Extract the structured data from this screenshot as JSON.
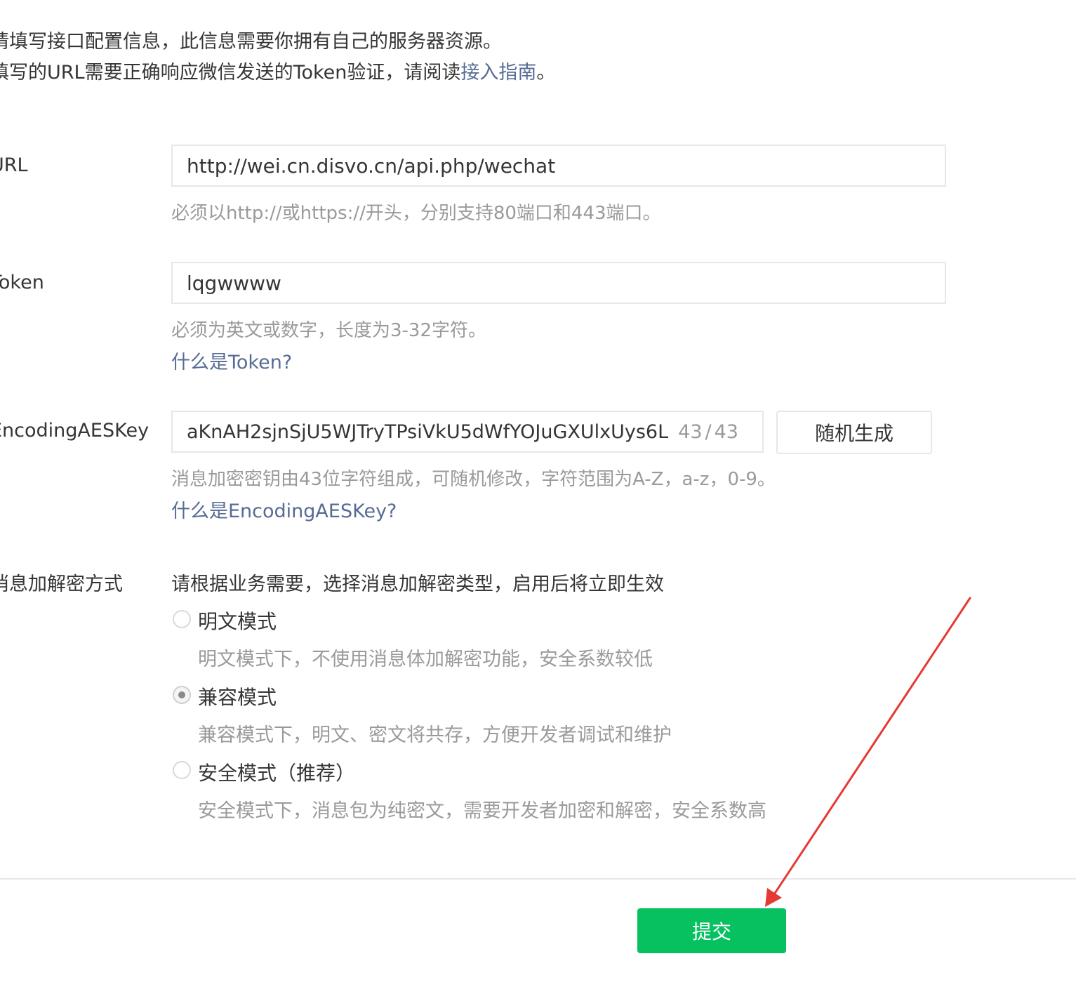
{
  "intro": {
    "line1": "请填写接口配置信息，此信息需要你拥有自己的服务器资源。",
    "line2_prefix": "填写的URL需要正确响应微信发送的Token验证，请阅读",
    "line2_link": "接入指南",
    "line2_suffix": "。"
  },
  "fields": {
    "url": {
      "label": "URL",
      "value": "http://wei.cn.disvo.cn/api.php/wechat",
      "hint": "必须以http://或https://开头，分别支持80端口和443端口。"
    },
    "token": {
      "label": "Token",
      "value": "lqgwwww",
      "hint": "必须为英文或数字，长度为3-32字符。",
      "help_link": "什么是Token?"
    },
    "aeskey": {
      "label": "EncodingAESKey",
      "value": "aKnAH2sjnSjU5WJTryTPsiVkU5dWfYOJuGXUlxUys6L",
      "count": "43",
      "count_sep": "/",
      "count_max": "43",
      "random_button": "随机生成",
      "hint": "消息加密密钥由43位字符组成，可随机修改，字符范围为A-Z，a-z，0-9。",
      "help_link": "什么是EncodingAESKey?"
    },
    "encryption": {
      "label": "消息加解密方式",
      "description": "请根据业务需要，选择消息加解密类型，启用后将立即生效",
      "options": [
        {
          "label": "明文模式",
          "desc": "明文模式下，不使用消息体加解密功能，安全系数较低",
          "checked": false
        },
        {
          "label": "兼容模式",
          "desc": "兼容模式下，明文、密文将共存，方便开发者调试和维护",
          "checked": true
        },
        {
          "label": "安全模式（推荐）",
          "desc": "安全模式下，消息包为纯密文，需要开发者加密和解密，安全系数高",
          "checked": false
        }
      ]
    }
  },
  "submit_button": "提交",
  "colors": {
    "primary_green": "#07c160",
    "link_blue": "#576b95",
    "annotation_arrow": "#e53935"
  }
}
